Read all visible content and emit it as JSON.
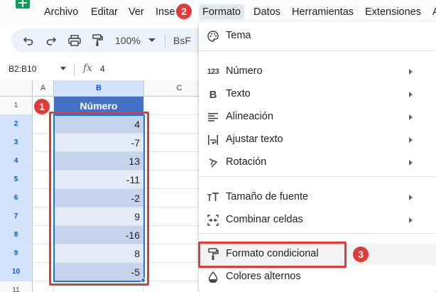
{
  "menu": {
    "items": [
      "Archivo",
      "Editar",
      "Ver",
      "Inse",
      "Formato",
      "Datos",
      "Herramientas",
      "Extensiones",
      "A"
    ],
    "active_index": 4
  },
  "toolbar": {
    "zoom": "100%",
    "font_name": "BsF",
    "icons": [
      "undo-icon",
      "redo-icon",
      "print-icon",
      "paint-format-icon"
    ]
  },
  "formula_bar": {
    "name_box": "B2:B10",
    "fx": "fx",
    "value": "4"
  },
  "grid": {
    "columns": [
      "A",
      "B",
      "C"
    ],
    "rows": [
      "1",
      "2",
      "3",
      "4",
      "5",
      "6",
      "7",
      "8",
      "9",
      "10",
      "11"
    ],
    "header": "Número",
    "values": [
      "4",
      "-7",
      "13",
      "-11",
      "-2",
      "9",
      "-16",
      "8",
      "-5"
    ]
  },
  "format_menu": {
    "items": [
      {
        "label": "Tema",
        "icon": "palette-icon",
        "submenu": false
      },
      {
        "label": "Número",
        "icon": "number-format-icon",
        "submenu": true
      },
      {
        "label": "Texto",
        "icon": "bold-icon",
        "submenu": true
      },
      {
        "label": "Alineación",
        "icon": "align-left-icon",
        "submenu": true
      },
      {
        "label": "Ajustar texto",
        "icon": "wrap-text-icon",
        "submenu": true
      },
      {
        "label": "Rotación",
        "icon": "text-rotation-icon",
        "submenu": true
      },
      {
        "label": "Tamaño de fuente",
        "icon": "font-size-icon",
        "submenu": true
      },
      {
        "label": "Combinar celdas",
        "icon": "merge-cells-icon",
        "submenu": true
      },
      {
        "label": "Formato condicional",
        "icon": "paint-roller-icon",
        "submenu": false
      },
      {
        "label": "Colores alternos",
        "icon": "fill-drop-icon",
        "submenu": false
      }
    ],
    "number_icon_text": "123",
    "bold_icon_text": "B"
  },
  "badges": [
    "1",
    "2",
    "3"
  ],
  "colors": {
    "header_fill": "#4472c4",
    "band_dark": "#c5d3ed",
    "band_light": "#e4ebf7",
    "selection": "#1a73e8",
    "annotation_red": "#e53935"
  }
}
